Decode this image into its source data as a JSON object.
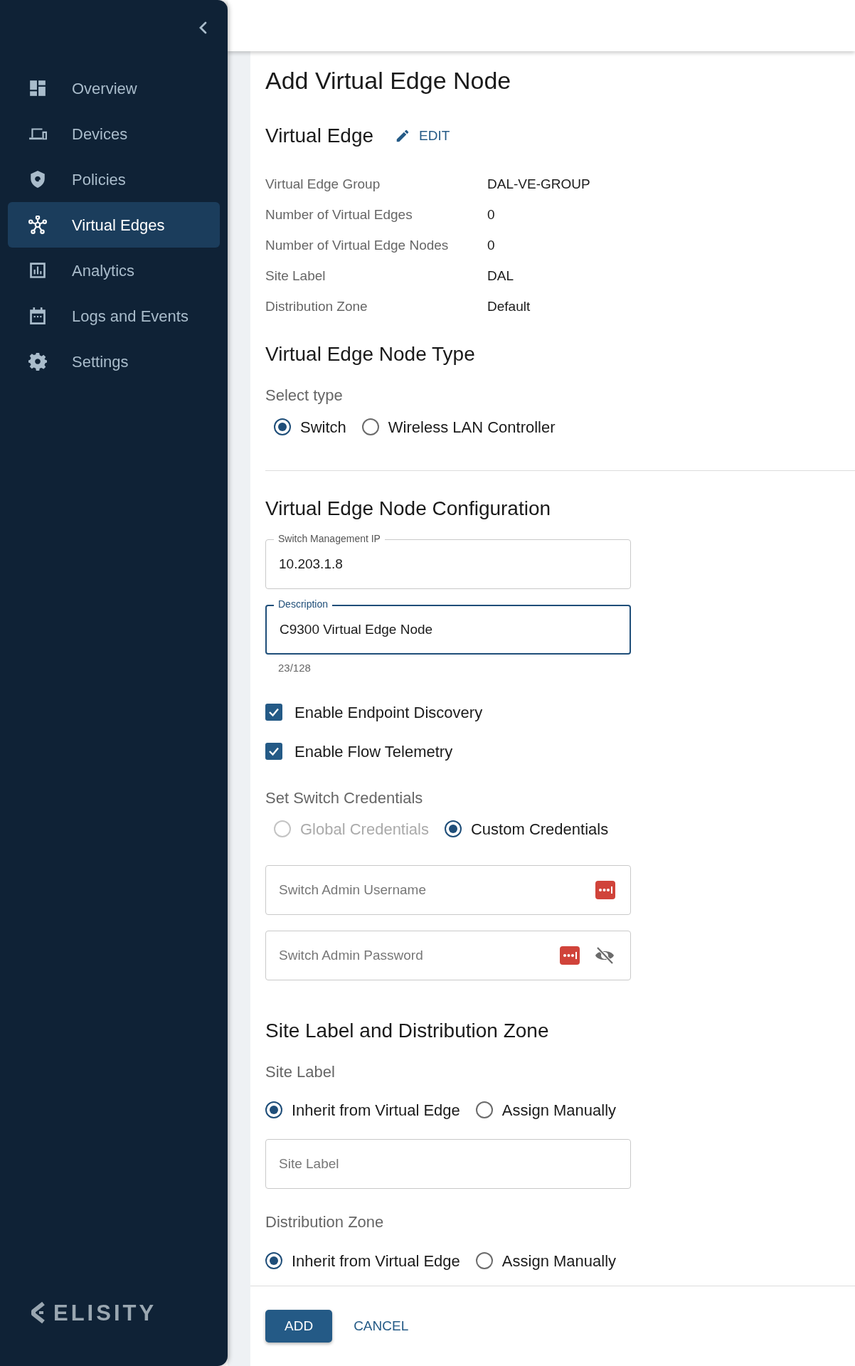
{
  "sidebar": {
    "items": [
      {
        "label": "Overview",
        "selected": false
      },
      {
        "label": "Devices",
        "selected": false
      },
      {
        "label": "Policies",
        "selected": false
      },
      {
        "label": "Virtual Edges",
        "selected": true
      },
      {
        "label": "Analytics",
        "selected": false
      },
      {
        "label": "Logs and Events",
        "selected": false
      },
      {
        "label": "Settings",
        "selected": false
      }
    ],
    "logo": "ELISITY"
  },
  "page_title": "Add Virtual Edge Node",
  "virtual_edge": {
    "heading": "Virtual Edge",
    "edit_label": "EDIT",
    "details": [
      {
        "label": "Virtual Edge Group",
        "value": "DAL-VE-GROUP"
      },
      {
        "label": "Number of Virtual Edges",
        "value": "0"
      },
      {
        "label": "Number of Virtual Edge Nodes",
        "value": "0"
      },
      {
        "label": "Site Label",
        "value": "DAL"
      },
      {
        "label": "Distribution Zone",
        "value": "Default"
      }
    ]
  },
  "node_type": {
    "heading": "Virtual Edge Node Type",
    "prompt": "Select type",
    "options": [
      {
        "label": "Switch",
        "selected": true
      },
      {
        "label": "Wireless LAN Controller",
        "selected": false
      }
    ]
  },
  "configuration": {
    "heading": "Virtual Edge Node Configuration",
    "fields": [
      {
        "label": "Switch Management IP",
        "value": "10.203.1.8",
        "focused": false
      },
      {
        "label": "Description",
        "value": "C9300 Virtual Edge Node",
        "focused": true,
        "counter": "23/128"
      }
    ],
    "checkboxes": [
      {
        "label": "Enable Endpoint Discovery",
        "checked": true
      },
      {
        "label": "Enable Flow Telemetry",
        "checked": true
      }
    ],
    "credentials": {
      "prompt": "Set Switch Credentials",
      "options": [
        {
          "label": "Global Credentials",
          "selected": false,
          "disabled": true
        },
        {
          "label": "Custom Credentials",
          "selected": true,
          "disabled": false
        }
      ]
    },
    "username": {
      "placeholder": "Switch Admin Username"
    },
    "password": {
      "placeholder": "Switch Admin Password"
    }
  },
  "site_section": {
    "heading": "Site Label and Distribution Zone",
    "site_label": {
      "prompt": "Site Label",
      "options": [
        {
          "label": "Inherit from Virtual Edge",
          "selected": true
        },
        {
          "label": "Assign Manually",
          "selected": false
        }
      ],
      "placeholder": "Site Label"
    },
    "distribution_zone": {
      "prompt": "Distribution Zone",
      "options": [
        {
          "label": "Inherit from Virtual Edge",
          "selected": true
        },
        {
          "label": "Assign Manually",
          "selected": false
        }
      ]
    }
  },
  "actions": {
    "primary": "ADD",
    "secondary": "CANCEL"
  }
}
